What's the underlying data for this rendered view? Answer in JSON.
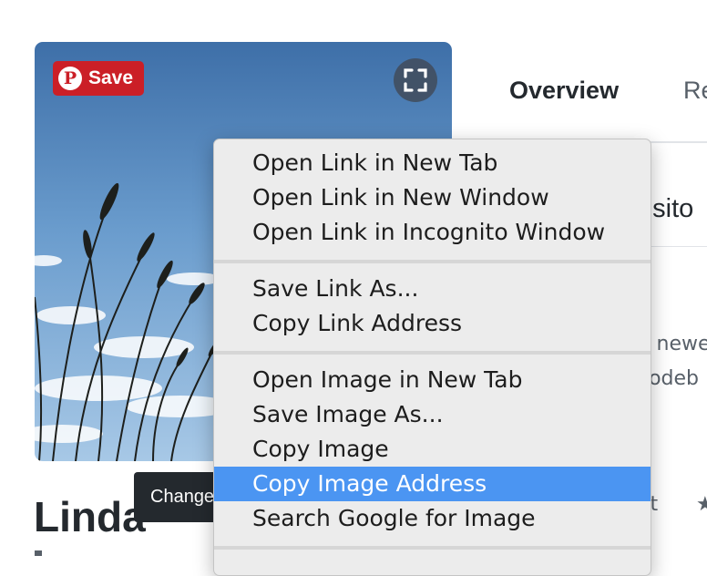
{
  "photo": {
    "save_label": "Save",
    "pin_glyph": "P",
    "icons": {
      "pinterest": "pinterest-logo-icon",
      "expand": "expand-corners-icon"
    }
  },
  "profile": {
    "name": "Linda",
    "change_tooltip": "Change"
  },
  "nav": {
    "tabs": [
      {
        "label": "Overview",
        "selected": true
      },
      {
        "label": "Re"
      }
    ]
  },
  "background": {
    "repo_heading": "osito",
    "line1": "e newe",
    "line2": "codeb",
    "line3": "ot",
    "star_glyph": "★"
  },
  "context_menu": {
    "groups": [
      [
        {
          "label": "Open Link in New Tab"
        },
        {
          "label": "Open Link in New Window"
        },
        {
          "label": "Open Link in Incognito Window"
        }
      ],
      [
        {
          "label": "Save Link As..."
        },
        {
          "label": "Copy Link Address"
        }
      ],
      [
        {
          "label": "Open Image in New Tab"
        },
        {
          "label": "Save Image As..."
        },
        {
          "label": "Copy Image"
        },
        {
          "label": "Copy Image Address",
          "highlighted": true
        },
        {
          "label": "Search Google for Image"
        }
      ]
    ]
  },
  "colors": {
    "pinterest_red": "#cb1f27",
    "highlight_blue": "#4b95f2",
    "menu_bg": "#ececec",
    "tooltip_bg": "#24292e"
  }
}
